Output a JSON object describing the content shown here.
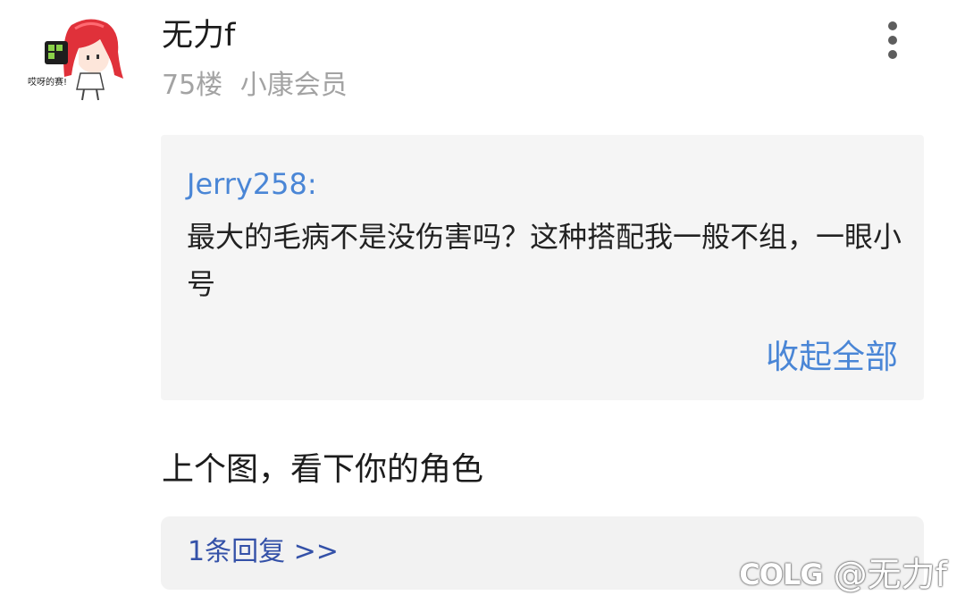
{
  "post": {
    "avatar_caption": "哎呀的赛!",
    "username": "无力f",
    "floor": "75楼",
    "member_level": "小康会员",
    "more_icon": "more-vertical-icon",
    "quote": {
      "author": "Jerry258:",
      "text": "最大的毛病不是没伤害吗？这种搭配我一般不组，一眼小号",
      "collapse_label": "收起全部"
    },
    "body": "上个图，看下你的角色",
    "replies_label": "1条回复 >>"
  },
  "watermark": {
    "logo": "COLG",
    "handle": "@无力f"
  },
  "colors": {
    "link_blue": "#4a86d6",
    "reply_blue": "#3451a8",
    "meta_gray": "#a3a3a3",
    "quote_bg": "#f5f5f5"
  }
}
